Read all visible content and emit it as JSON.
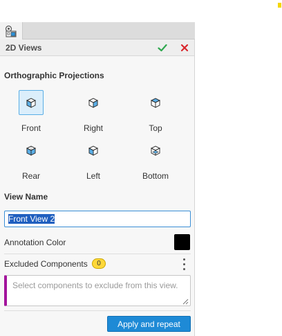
{
  "panel": {
    "tab_icon": "drawing-views-icon",
    "title": "2D Views",
    "ok_icon": "checkmark-icon",
    "cancel_icon": "close-icon",
    "accent_ok": "#2fa84f",
    "accent_cancel": "#d9262c"
  },
  "orthographic": {
    "heading": "Orthographic Projections",
    "views": [
      {
        "label": "Front",
        "icon": "front-view-cube-icon",
        "selected": true
      },
      {
        "label": "Right",
        "icon": "right-view-cube-icon",
        "selected": false
      },
      {
        "label": "Top",
        "icon": "top-view-cube-icon",
        "selected": false
      },
      {
        "label": "Rear",
        "icon": "rear-view-cube-icon",
        "selected": false
      },
      {
        "label": "Left",
        "icon": "left-view-cube-icon",
        "selected": false
      },
      {
        "label": "Bottom",
        "icon": "bottom-view-cube-icon",
        "selected": false
      }
    ]
  },
  "view_name": {
    "heading": "View Name",
    "value": "Front View 2"
  },
  "annotation": {
    "label": "Annotation Color",
    "color": "#000000"
  },
  "excluded": {
    "label": "Excluded Components",
    "count": "0",
    "placeholder": "Select components to exclude from this view.",
    "menu_icon": "more-vertical-icon",
    "accent": "#a3149c"
  },
  "footer": {
    "apply_label": "Apply and repeat",
    "accent": "#1e8ad6"
  }
}
